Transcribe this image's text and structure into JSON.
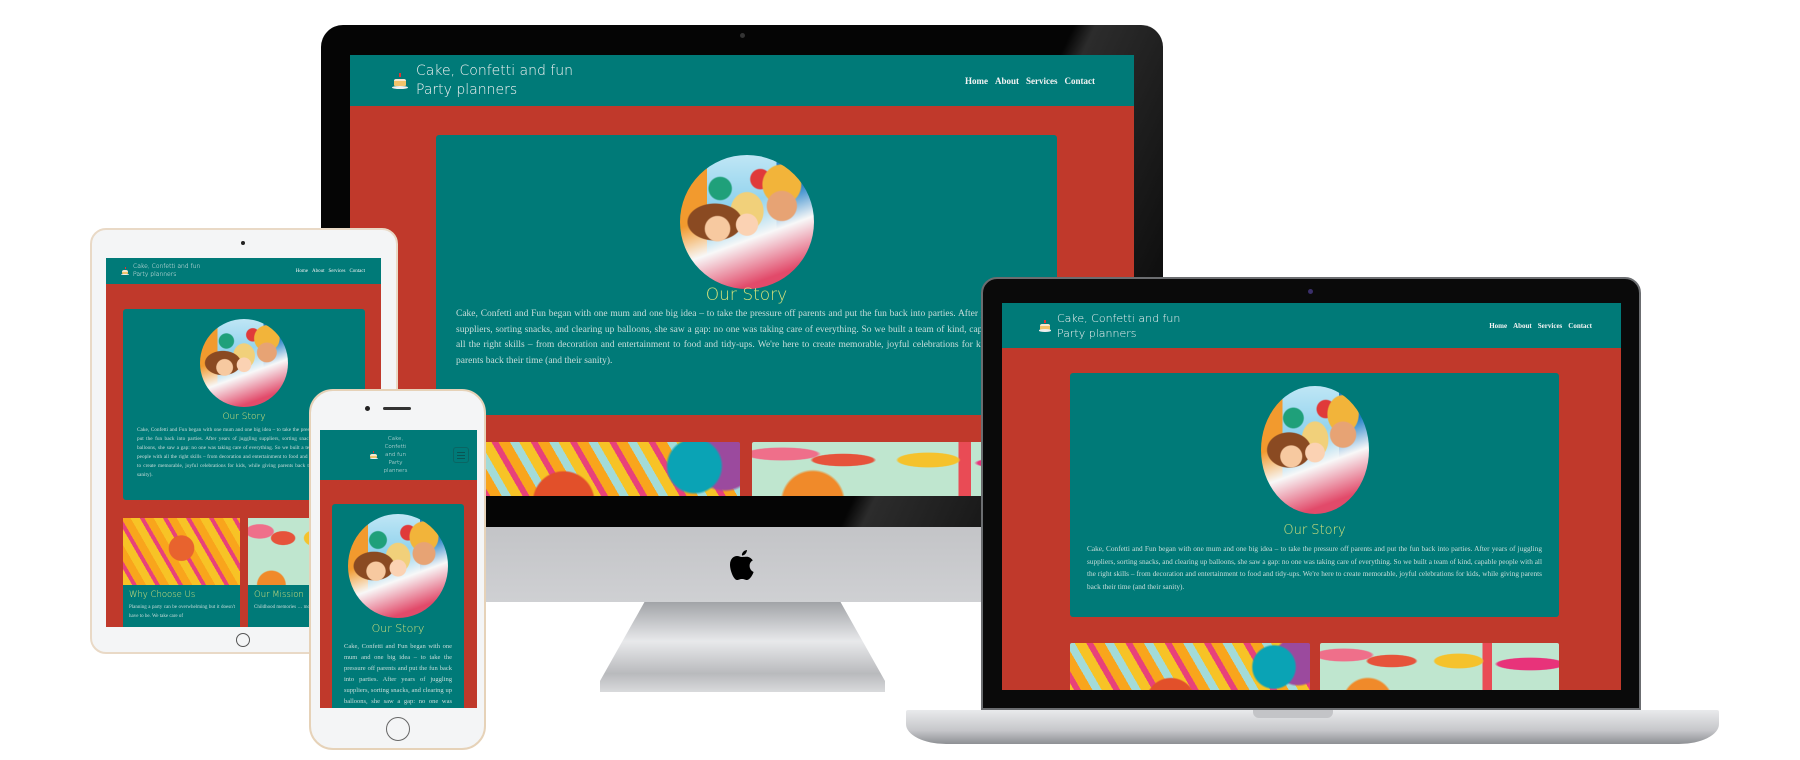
{
  "site": {
    "brand_line1": "Cake, Confetti and fun",
    "brand_line2": "Party planners",
    "phone_brand": [
      "Cake,",
      "Confetti",
      "and fun",
      "Party",
      "planners"
    ],
    "nav": [
      "Home",
      "About",
      "Services",
      "Contact"
    ],
    "story_title": "Our Story",
    "story_text": "Cake, Confetti and Fun began with one mum and one big idea – to take the pressure off parents and put the fun back into parties. After years of juggling suppliers, sorting snacks, and clearing up balloons, she saw a gap: no one was taking care of everything. So we built a team of kind, capable people with all the right skills – from decoration and entertainment to food and tidy-ups. We're here to create memorable, joyful celebrations for kids, while giving parents back their time (and their sanity).",
    "cards": [
      {
        "title": "Why Choose Us",
        "text": "Planning a party can be overwhelming but it doesn't have to be. We take care of"
      },
      {
        "title": "Our Mission",
        "text": "Childhood memories … moments of joy, and"
      }
    ]
  },
  "colors": {
    "teal": "#007a78",
    "red": "#c0392b",
    "heading": "#d6e27c"
  },
  "icons": {
    "logo": "cake-icon",
    "menu": "hamburger-icon",
    "brand": "apple-logo-icon"
  }
}
